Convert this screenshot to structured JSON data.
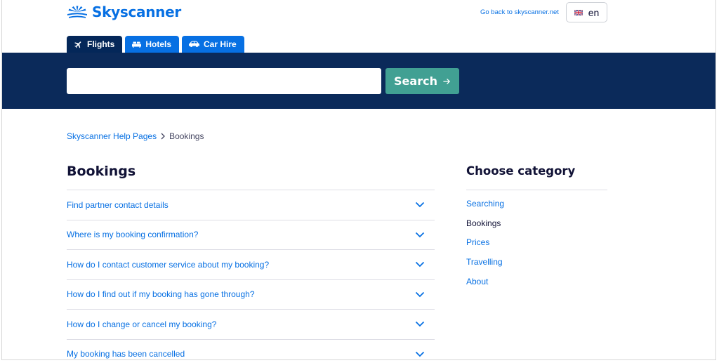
{
  "header": {
    "logo_text": "Skyscanner",
    "go_back_link": "Go back to skyscanner.net",
    "language": "en"
  },
  "tabs": [
    {
      "label": "Flights",
      "icon": "plane-icon",
      "active": true
    },
    {
      "label": "Hotels",
      "icon": "bed-icon",
      "active": false
    },
    {
      "label": "Car Hire",
      "icon": "car-icon",
      "active": false
    }
  ],
  "search": {
    "value": "",
    "placeholder": "",
    "button_label": "Search"
  },
  "breadcrumb": {
    "root": "Skyscanner Help Pages",
    "current": "Bookings"
  },
  "main": {
    "title": "Bookings",
    "articles": [
      "Find partner contact details",
      "Where is my booking confirmation?",
      "How do I contact customer service about my booking?",
      "How do I find out if my booking has gone through?",
      "How do I change or cancel my booking?",
      "My booking has been cancelled"
    ]
  },
  "sidebar": {
    "title": "Choose category",
    "categories": [
      {
        "label": "Searching",
        "current": false
      },
      {
        "label": "Bookings",
        "current": true
      },
      {
        "label": "Prices",
        "current": false
      },
      {
        "label": "Travelling",
        "current": false
      },
      {
        "label": "About",
        "current": false
      }
    ]
  },
  "colors": {
    "brand_blue": "#0770e3",
    "navy_band": "#0b2a5a",
    "active_tab": "#042759",
    "search_button": "#41a093"
  }
}
